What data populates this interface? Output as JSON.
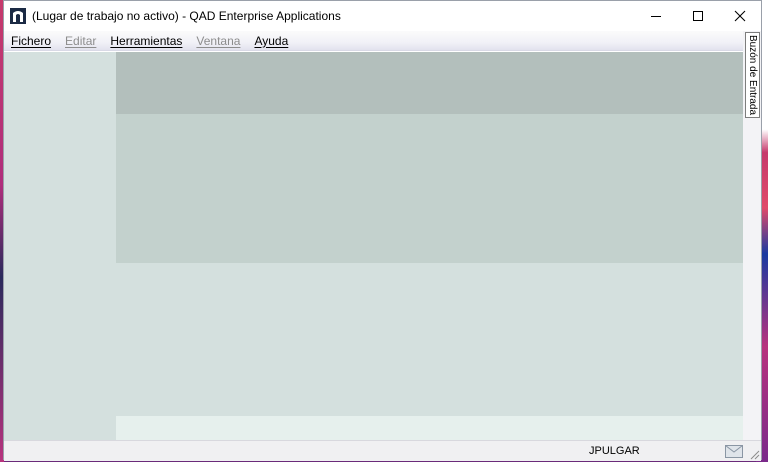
{
  "window": {
    "title": "(Lugar de trabajo no activo) - QAD Enterprise Applications",
    "app_icon": "qad-app-icon",
    "controls": [
      "minimize-icon",
      "maximize-icon",
      "close-icon"
    ]
  },
  "menu": {
    "items": [
      {
        "label": "Fichero",
        "enabled": true
      },
      {
        "label": "Editar",
        "enabled": false
      },
      {
        "label": "Herramientas",
        "enabled": true
      },
      {
        "label": "Ventana",
        "enabled": false
      },
      {
        "label": "Ayuda",
        "enabled": true
      }
    ]
  },
  "side_tab": {
    "label": "Buzón de Entrada"
  },
  "status": {
    "user": "JPULGAR",
    "icon": "mail-icon"
  },
  "colors": {
    "nav_panel": "#d4e0de",
    "band_dark": "#b3bfbc",
    "band_mid": "#c3d1cd",
    "band_light": "#e6f0ed"
  }
}
